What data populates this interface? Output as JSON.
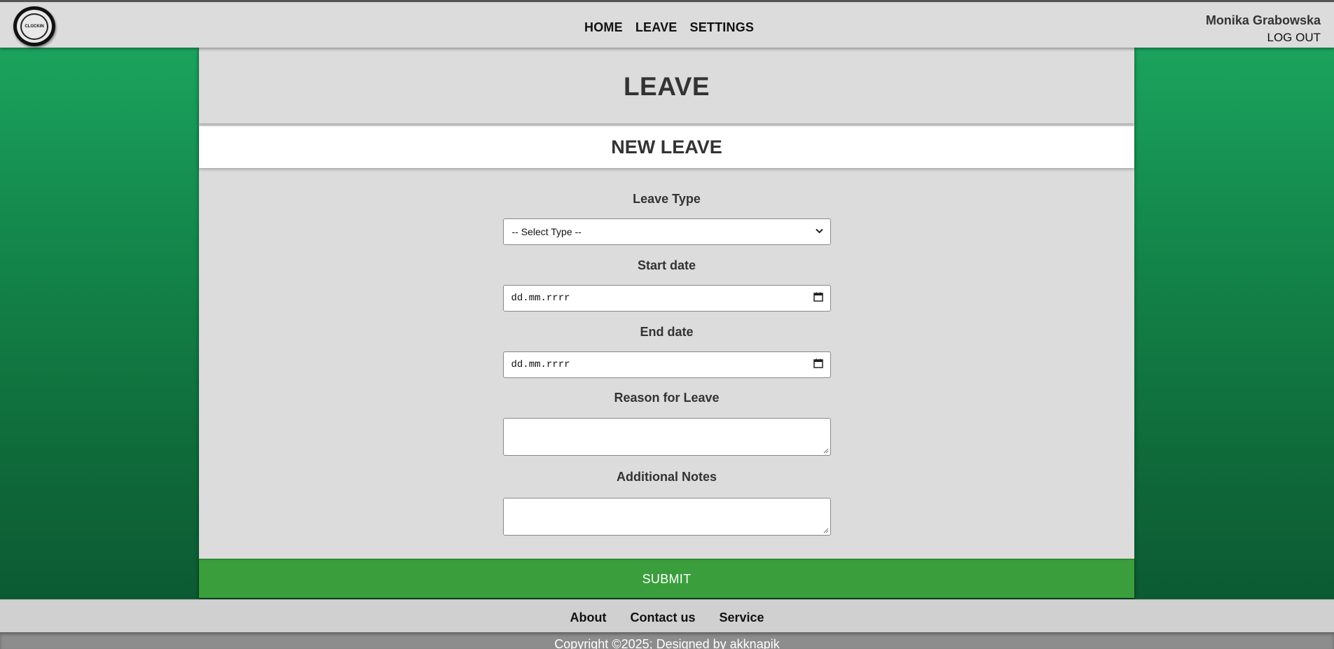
{
  "header": {
    "logo_text": "CLOCKIN",
    "nav": [
      {
        "label": "HOME"
      },
      {
        "label": "LEAVE"
      },
      {
        "label": "SETTINGS"
      }
    ],
    "user_name": "Monika Grabowska",
    "logout_label": "LOG OUT"
  },
  "main": {
    "page_title": "LEAVE",
    "section_title": "NEW LEAVE",
    "fields": {
      "leave_type_label": "Leave Type",
      "leave_type_value": "-- Select Type --",
      "start_date_label": "Start date",
      "start_date_value": "dd.mm.rrrr",
      "end_date_label": "End date",
      "end_date_value": "dd.mm.rrrr",
      "reason_label": "Reason for Leave",
      "notes_label": "Additional Notes"
    },
    "submit_label": "SUBMIT"
  },
  "footer": {
    "links": [
      {
        "label": "About"
      },
      {
        "label": "Contact us"
      },
      {
        "label": "Service"
      }
    ],
    "copyright": "Copyright ©2025; Designed by akknapik"
  },
  "colors": {
    "accent_green": "#3a9e3c",
    "background_gradient_top": "#1daa62",
    "background_gradient_bottom": "#0b5530"
  }
}
